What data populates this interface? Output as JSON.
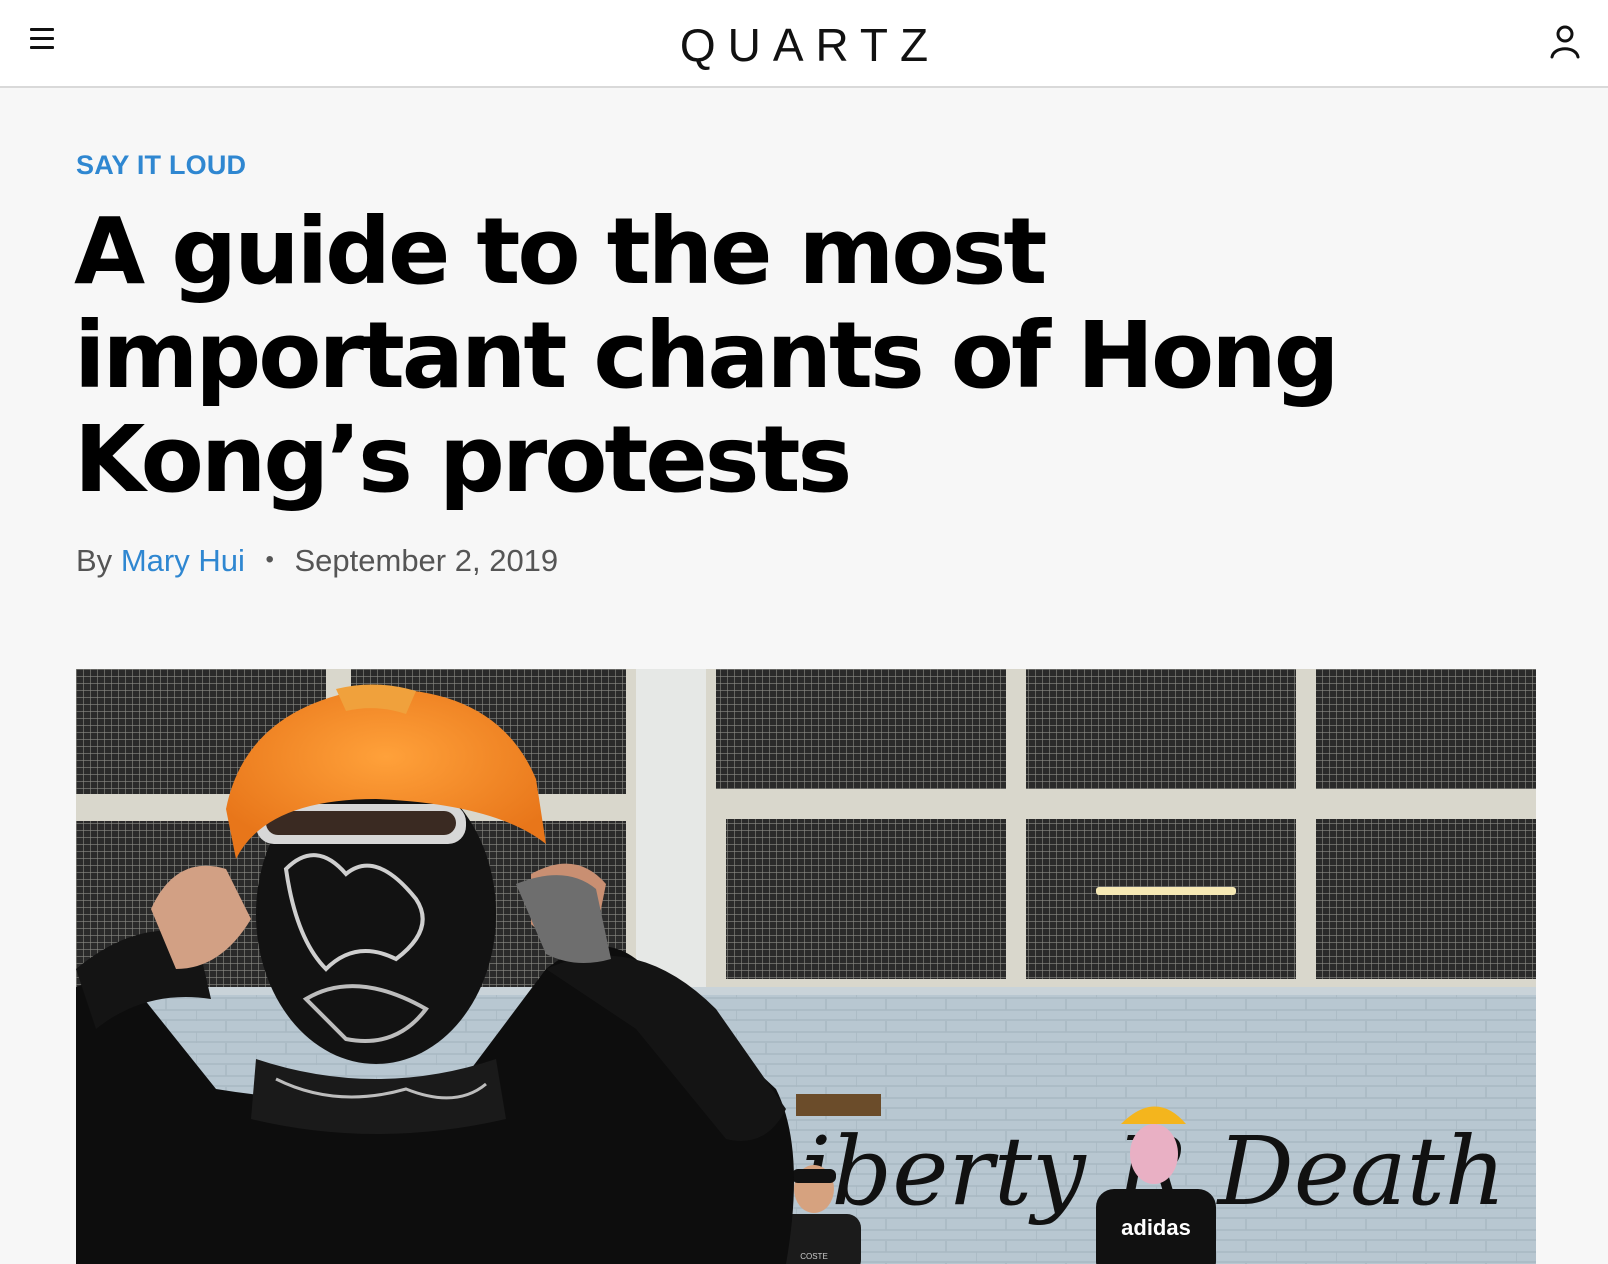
{
  "header": {
    "logo": "QUARTZ",
    "menu_icon": "hamburger-menu-icon",
    "user_icon": "user-account-icon"
  },
  "article": {
    "kicker": "SAY IT LOUD",
    "headline": "A guide to the most important chants of Hong Kong’s protests",
    "byline_prefix": "By",
    "author": "Mary Hui",
    "separator": "•",
    "date": "September 2, 2019"
  },
  "hero_image": {
    "graffiti_text": "iberty R Death",
    "shirt_text": "adidas",
    "cap_text": "COSTE"
  },
  "colors": {
    "accent": "#2f87d1",
    "headline": "#000000",
    "background": "#f7f7f7"
  }
}
